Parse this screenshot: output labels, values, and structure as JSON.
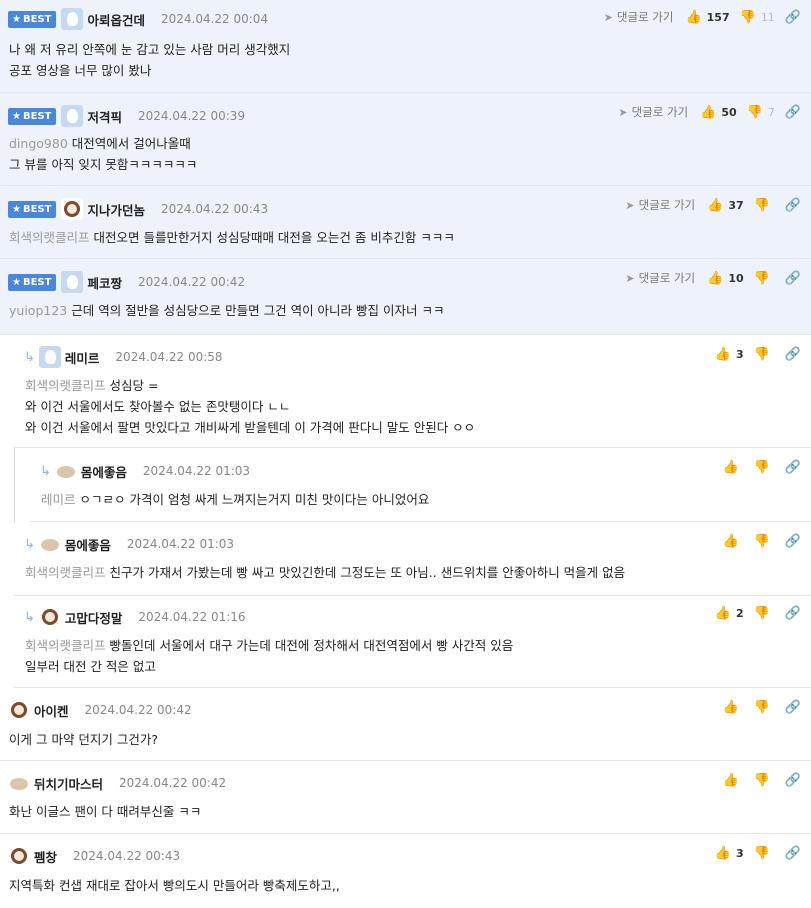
{
  "labels": {
    "best": "BEST",
    "goto_reply": "댓글로 가기"
  },
  "icons": {
    "star": "star-icon",
    "arrow": "arrow-icon",
    "thumb_up": "thumbs-up-icon",
    "thumb_down": "thumbs-down-icon",
    "link": "link-icon",
    "reply": "reply-arrow-icon"
  },
  "colors": {
    "best_badge": "#4a86d9",
    "best_background": "#eef3fb"
  },
  "comments": [
    {
      "nick": "아뢰옵건데",
      "date": "2024.04.22 00:04",
      "up": "157",
      "down": "11",
      "lines": [
        "나 왜 저 유리 안쪽에 눈 감고 있는 사람 머리 생각했지",
        "공포 영상을 너무 많이 봤나"
      ],
      "mention": ""
    },
    {
      "nick": "저격픽",
      "date": "2024.04.22 00:39",
      "up": "50",
      "down": "7",
      "mention": "dingo980",
      "lines": [
        "대전역에서 걸어나올때",
        "그 뷰를 아직 잊지 못함ㅋㅋㅋㅋㅋㅋ"
      ]
    },
    {
      "nick": "지나가던놈",
      "date": "2024.04.22 00:43",
      "up": "37",
      "down": "",
      "mention": "회색의랫클리프",
      "lines": [
        "대전오면 들를만한거지 성심당때매 대전을 오는건 좀 비추긴함 ㅋㅋㅋ"
      ]
    },
    {
      "nick": "페코짱",
      "date": "2024.04.22 00:42",
      "up": "10",
      "down": "",
      "mention": "yuiop123",
      "lines": [
        "근데 역의 절반을 성심당으로 만들면 그건 역이 아니라 빵집 이자너 ㅋㅋ"
      ]
    },
    {
      "nick": "레미르",
      "date": "2024.04.22 00:58",
      "up": "3",
      "down": "",
      "mention": "회색의랫클리프",
      "lines": [
        "성심당 =",
        "와 이건 서울에서도 찾아볼수 없는 존맛탱이다 ㄴㄴ",
        "와 이건 서울에서 팔면 맛있다고 개비싸게 받을텐데 이 가격에 판다니 말도 안된다 ㅇㅇ"
      ]
    },
    {
      "nick": "몸에좋음",
      "date": "2024.04.22 01:03",
      "up": "",
      "down": "",
      "mention": "레미르",
      "lines": [
        "ㅇㄱㄹㅇ 가격이 엄청 싸게 느껴지는거지 미친 맛이다는 아니었어요"
      ]
    },
    {
      "nick": "몸에좋음",
      "date": "2024.04.22 01:03",
      "up": "",
      "down": "",
      "mention": "회색의랫클리프",
      "lines": [
        "친구가 가재서 가봤는데 빵 싸고 맛있긴한데 그정도는 또 아님.. 샌드위치를 안좋아하니 먹을게 없음"
      ]
    },
    {
      "nick": "고맙다정말",
      "date": "2024.04.22 01:16",
      "up": "2",
      "down": "",
      "mention": "회색의랫클리프",
      "lines": [
        "빵돌인데 서울에서 대구 가는데 대전에 정차해서 대전역점에서 빵 사간적 있음",
        "일부러 대전 간 적은 없고"
      ]
    },
    {
      "nick": "아이켄",
      "date": "2024.04.22 00:42",
      "up": "",
      "down": "",
      "mention": "",
      "lines": [
        "이게 그 마약 던지기 그건가?"
      ]
    },
    {
      "nick": "뒤치기마스터",
      "date": "2024.04.22 00:42",
      "up": "",
      "down": "",
      "mention": "",
      "lines": [
        "화난 이글스 팬이 다 때려부신줄 ㅋㅋ"
      ]
    },
    {
      "nick": "펨창",
      "date": "2024.04.22 00:43",
      "up": "3",
      "down": "",
      "mention": "",
      "lines": [
        "지역특화 컨샙 재대로 잡아서 빵의도시 만들어라 빵축제도하고,,"
      ]
    }
  ]
}
